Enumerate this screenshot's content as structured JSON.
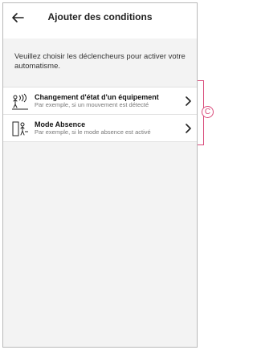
{
  "header": {
    "title": "Ajouter des conditions",
    "back_icon": "arrow-left-icon"
  },
  "intro": "Veuillez choisir les déclencheurs pour activer votre automatisme.",
  "conditions": [
    {
      "title": "Changement d'état d'un équipement",
      "subtitle": "Par exemple, si un mouvement est détecté",
      "icon": "motion-sensor-person-icon"
    },
    {
      "title": "Mode Absence",
      "subtitle": "Par exemple, si le mode absence est activé",
      "icon": "away-mode-icon"
    }
  ],
  "annotation": {
    "label": "C",
    "color": "#d94a7a"
  }
}
